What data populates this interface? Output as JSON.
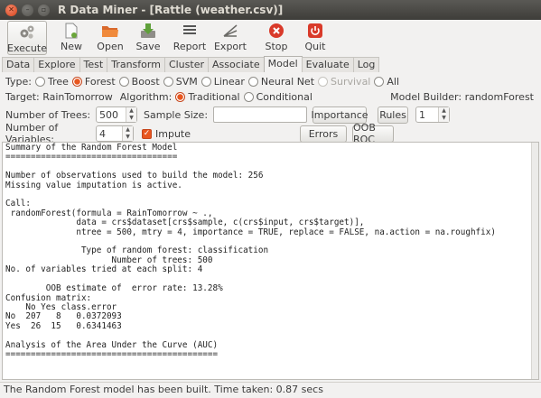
{
  "window": {
    "title": "R Data Miner - [Rattle (weather.csv)]"
  },
  "toolbar": {
    "buttons": [
      {
        "label": "Execute",
        "icon": "execute-gears-icon"
      },
      {
        "label": "New",
        "icon": "new-file-icon"
      },
      {
        "label": "Open",
        "icon": "open-folder-icon"
      },
      {
        "label": "Save",
        "icon": "save-download-icon"
      },
      {
        "label": "Report",
        "icon": "report-lines-icon"
      },
      {
        "label": "Export",
        "icon": "export-icon"
      },
      {
        "label": "Stop",
        "icon": "stop-icon"
      },
      {
        "label": "Quit",
        "icon": "power-icon"
      }
    ]
  },
  "tabs": [
    "Data",
    "Explore",
    "Test",
    "Transform",
    "Cluster",
    "Associate",
    "Model",
    "Evaluate",
    "Log"
  ],
  "active_tab": "Model",
  "model": {
    "type_label": "Type:",
    "types": [
      {
        "label": "Tree",
        "selected": false,
        "disabled": false
      },
      {
        "label": "Forest",
        "selected": true,
        "disabled": false
      },
      {
        "label": "Boost",
        "selected": false,
        "disabled": false
      },
      {
        "label": "SVM",
        "selected": false,
        "disabled": false
      },
      {
        "label": "Linear",
        "selected": false,
        "disabled": false
      },
      {
        "label": "Neural Net",
        "selected": false,
        "disabled": false
      },
      {
        "label": "Survival",
        "selected": false,
        "disabled": true
      },
      {
        "label": "All",
        "selected": false,
        "disabled": false
      }
    ],
    "target_text": "Target: RainTomorrow",
    "algorithm_label": "Algorithm:",
    "algorithms": [
      {
        "label": "Traditional",
        "selected": true
      },
      {
        "label": "Conditional",
        "selected": false
      }
    ],
    "model_builder_text": "Model Builder: randomForest",
    "num_trees_label": "Number of Trees:",
    "num_trees_value": "500",
    "sample_size_label": "Sample Size:",
    "sample_size_value": "",
    "importance_button": "Importance",
    "rules_button": "Rules",
    "rules_value": "1",
    "num_vars_label": "Number of Variables:",
    "num_vars_value": "4",
    "impute_label": "Impute",
    "impute_checked": true,
    "errors_button": "Errors",
    "oob_roc_button": "OOB ROC"
  },
  "output_text": "Summary of the Random Forest Model\n==================================\n\nNumber of observations used to build the model: 256\nMissing value imputation is active.\n\nCall:\n randomForest(formula = RainTomorrow ~ .,\n              data = crs$dataset[crs$sample, c(crs$input, crs$target)],\n              ntree = 500, mtry = 4, importance = TRUE, replace = FALSE, na.action = na.roughfix)\n\n               Type of random forest: classification\n                     Number of trees: 500\nNo. of variables tried at each split: 4\n\n        OOB estimate of  error rate: 13.28%\nConfusion matrix:\n    No Yes class.error\nNo  207   8   0.0372093\nYes  26  15   0.6341463\n\nAnalysis of the Area Under the Curve (AUC)\n==========================================\n\n",
  "status_text": "The Random Forest model has been built. Time taken: 0.87 secs",
  "colors": {
    "accent": "#e8561f",
    "titlebar": "#3e3d39",
    "background": "#f2f1f0"
  }
}
